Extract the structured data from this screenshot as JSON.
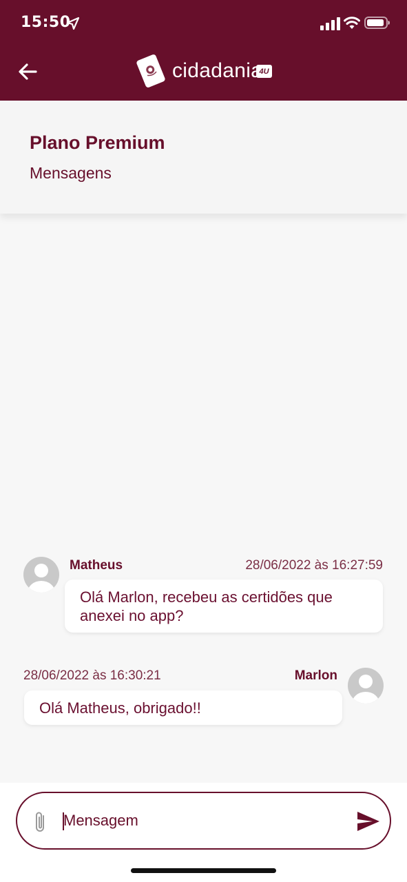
{
  "status_bar": {
    "time": "15:50"
  },
  "nav": {
    "logo_text": "cidadania",
    "logo_badge": "4U"
  },
  "plan": {
    "title": "Plano Premium",
    "subtitle": "Mensagens"
  },
  "messages": [
    {
      "sender": "Matheus",
      "timestamp": "28/06/2022 às 16:27:59",
      "text_line1": "Olá Marlon, recebeu as certidões que",
      "text_line2": "anexei no app?",
      "side": "left"
    },
    {
      "sender": "Marlon",
      "timestamp": "28/06/2022 às 16:30:21",
      "text_line1": "Olá Matheus, obrigado!!",
      "side": "right"
    }
  ],
  "composer": {
    "placeholder": "Mensagem"
  },
  "colors": {
    "brand": "#670f2b",
    "background": "#f7f7f7",
    "bubble": "#ffffff"
  },
  "icons": [
    "location-arrow-icon",
    "signal-icon",
    "wifi-icon",
    "battery-icon",
    "back-arrow-icon",
    "passport-logo-icon",
    "avatar-icon",
    "paperclip-icon",
    "send-icon"
  ]
}
